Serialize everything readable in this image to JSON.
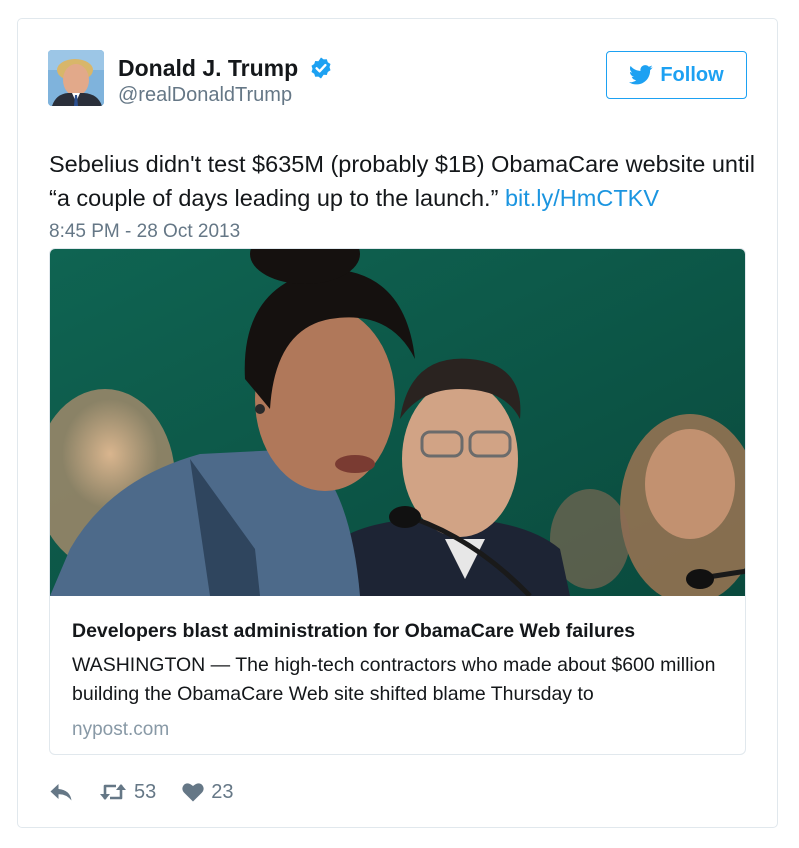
{
  "tweet": {
    "user": {
      "name": "Donald J. Trump",
      "handle": "@realDonaldTrump",
      "verified": true
    },
    "follow_label": "Follow",
    "text_main": "Sebelius didn't test $635M (probably $1B) ObamaCare website until “a couple of days leading up to the launch.” ",
    "text_link": "bit.ly/HmCTKV",
    "timestamp": "8:45 PM - 28 Oct 2013",
    "card": {
      "title": "Developers blast administration for ObamaCare Web failures",
      "description": "WASHINGTON — The high-tech contractors who made about $600 million building the ObamaCare Web site shifted blame Thursday to",
      "domain": "nypost.com"
    },
    "actions": {
      "reply_icon": "reply-icon",
      "retweet_icon": "retweet-icon",
      "retweet_count": "53",
      "like_icon": "heart-icon",
      "like_count": "23"
    }
  },
  "colors": {
    "brand_blue": "#1da1f2",
    "link_blue": "#1b95e0",
    "secondary_text": "#657786",
    "border": "#e1e8ed"
  }
}
